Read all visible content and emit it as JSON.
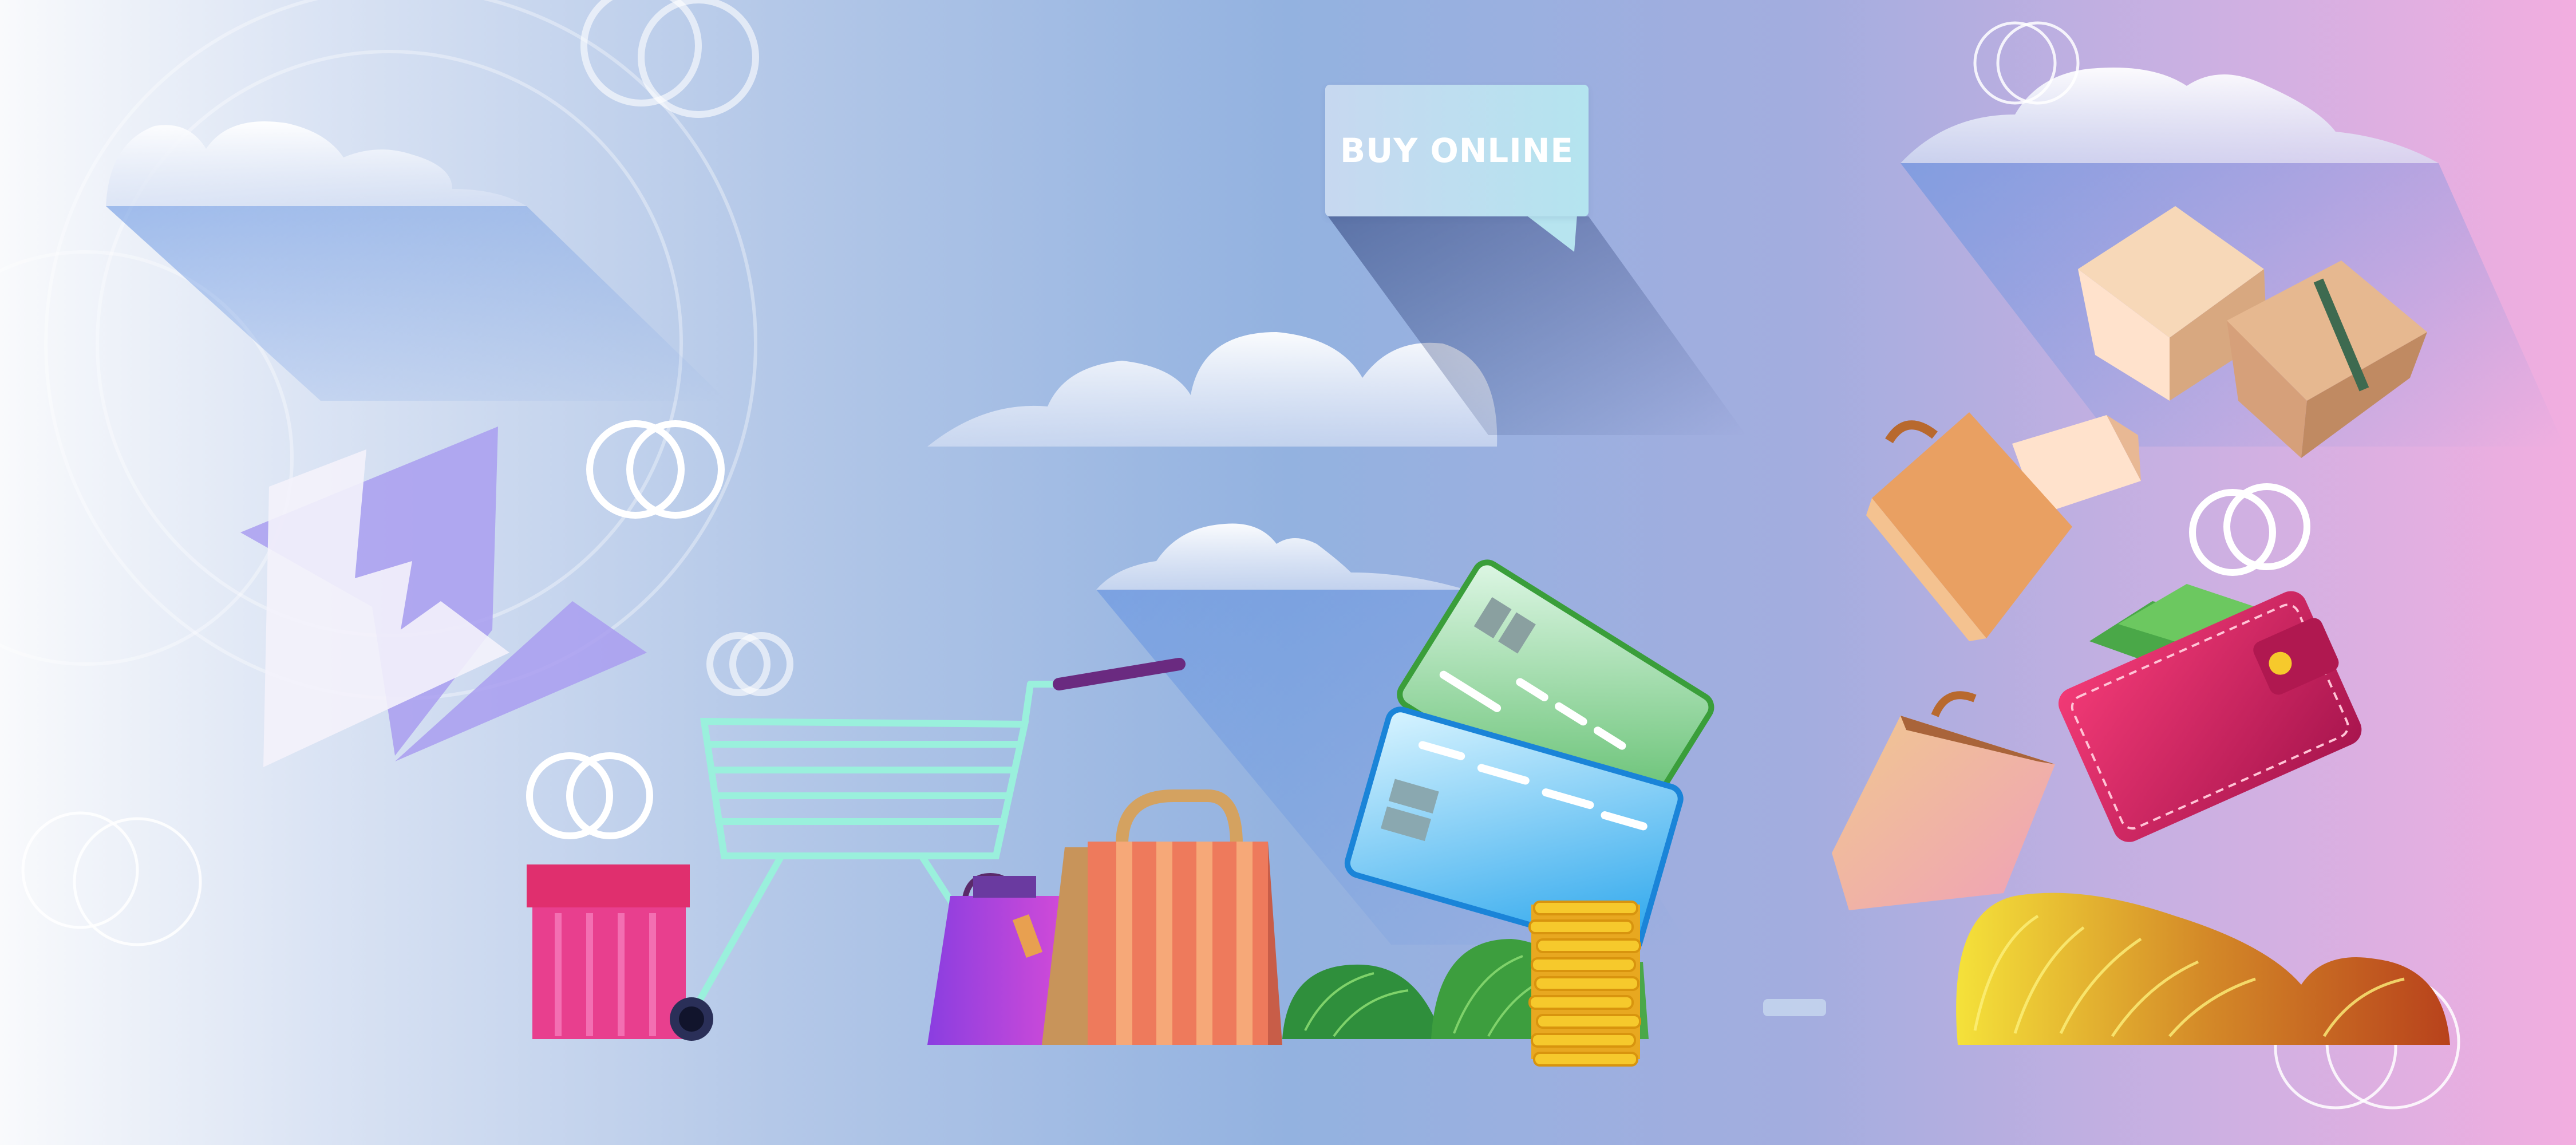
{
  "banner": {
    "label": "BUY ONLINE"
  },
  "colors": {
    "bg_left": "#f9fafc",
    "bg_mid": "#93b2e0",
    "bg_right": "#f2aee0",
    "cart": "#9af0dc",
    "gift_box": "#e83f8e",
    "wallet": "#e02c6c",
    "coins": "#f6c92c"
  },
  "icons": [
    "shopping-cart-icon",
    "gift-box-icon",
    "shopping-bag-icon",
    "credit-card-icon",
    "coin-stack-icon",
    "wallet-icon",
    "parcel-box-icon",
    "cloud-icon",
    "money-bill-icon"
  ]
}
